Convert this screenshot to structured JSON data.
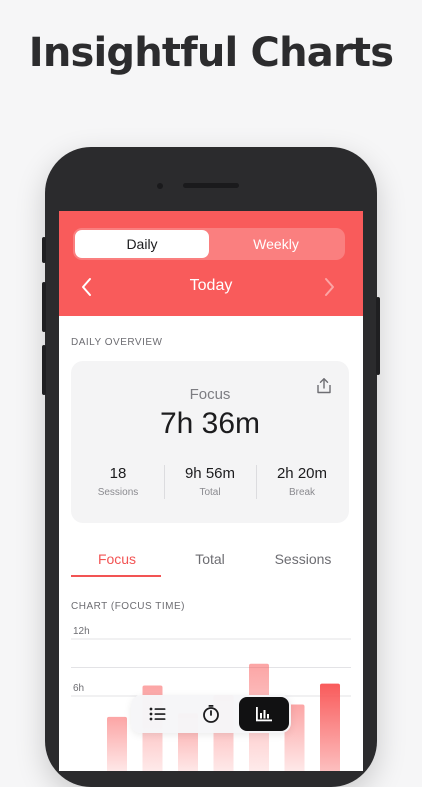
{
  "headline": "Insightful Charts",
  "segment": {
    "daily": "Daily",
    "weekly": "Weekly",
    "selected": "Daily"
  },
  "date_nav": {
    "title": "Today",
    "prev_icon": "chevron-left-icon",
    "next_icon": "chevron-right-icon"
  },
  "overview": {
    "section_label": "DAILY OVERVIEW",
    "focus_label": "Focus",
    "focus_value": "7h 36m",
    "stats": [
      {
        "value": "18",
        "label": "Sessions"
      },
      {
        "value": "9h 56m",
        "label": "Total"
      },
      {
        "value": "2h 20m",
        "label": "Break"
      }
    ],
    "share_icon": "share-icon"
  },
  "tabs": [
    {
      "label": "Focus",
      "active": true
    },
    {
      "label": "Total",
      "active": false
    },
    {
      "label": "Sessions",
      "active": false
    }
  ],
  "chart_label": "CHART (FOCUS TIME)",
  "chart_data": {
    "type": "bar",
    "yticks": [
      "12h",
      "6h"
    ],
    "ylim": [
      0,
      12
    ],
    "values": [
      3.8,
      7.1,
      4.2,
      6.1,
      9.4,
      5.1,
      7.3
    ],
    "colors": {
      "bar": "#f95b5b",
      "grid": "#e3e3e6"
    }
  },
  "dock": {
    "items": [
      {
        "icon": "list-icon",
        "active": false
      },
      {
        "icon": "timer-icon",
        "active": false
      },
      {
        "icon": "bar-chart-icon",
        "active": true
      }
    ]
  },
  "colors": {
    "accent": "#f95b5b",
    "background": "#f6f6f7"
  }
}
